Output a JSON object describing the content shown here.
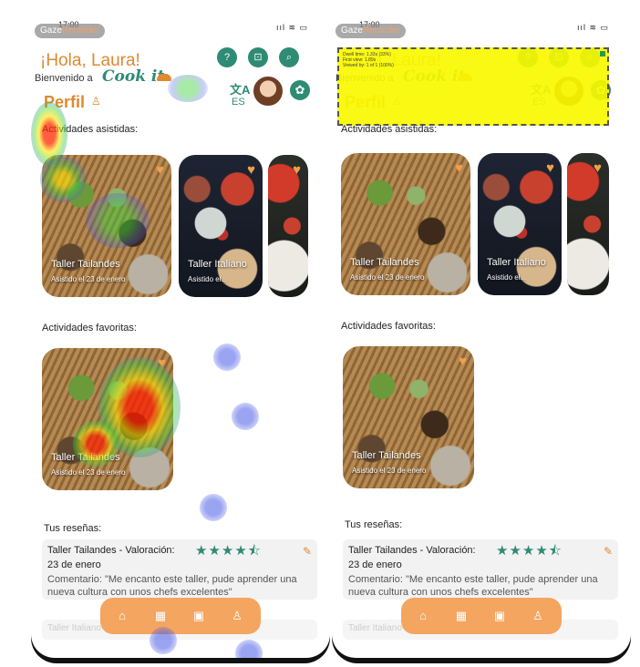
{
  "status": {
    "time": "17:00",
    "icons": "ııl ≋ ▭"
  },
  "gaze": {
    "prefix": "Gaze",
    "suffix": "Recorder"
  },
  "header": {
    "greeting": "¡Hola, Laura!",
    "welcome": "Bienvenido a",
    "brand": "Cook it",
    "perfil": "Perfil",
    "lang_code": "ES",
    "help_icon": "?",
    "cart_icon": "⊡",
    "search_icon": "⌕",
    "gear_icon": "✿",
    "lang_icon": "文A"
  },
  "sections": {
    "attended": "Actividades asistidas:",
    "favorites": "Actividades favoritas:",
    "reviews": "Tus reseñas:"
  },
  "cards": [
    {
      "title": "Taller Tailandes",
      "subtitle": "Asistido el 23 de enero"
    },
    {
      "title": "Taller Italiano",
      "subtitle": "Asistido el..."
    }
  ],
  "favorite_card": {
    "title": "Taller Tailandes",
    "subtitle": "Asistido el 23 de enero"
  },
  "review": {
    "title": "Taller Tailandes - Valoración:",
    "stars": "★★★★⯪",
    "date": "23 de enero",
    "comment": "Comentario: \"Me encanto este taller, pude aprender una nueva cultura con unos chefs excelentes\"",
    "next_title": "Taller Italiano"
  },
  "navbar": {
    "home": "⌂",
    "calendar": "▦",
    "gallery": "▣",
    "profile": "♙"
  },
  "overlay": {
    "line1": "Dwell time: 1.33s (33%)",
    "line2": "First view: 1.89s",
    "line3": "Viewed by: 1 of 1 (100%)"
  },
  "colors": {
    "orange": "#e0892f",
    "teal": "#2e8b74",
    "navbar": "#f4a560",
    "heart": "#f0a04a",
    "overlay": "#f8f800"
  }
}
